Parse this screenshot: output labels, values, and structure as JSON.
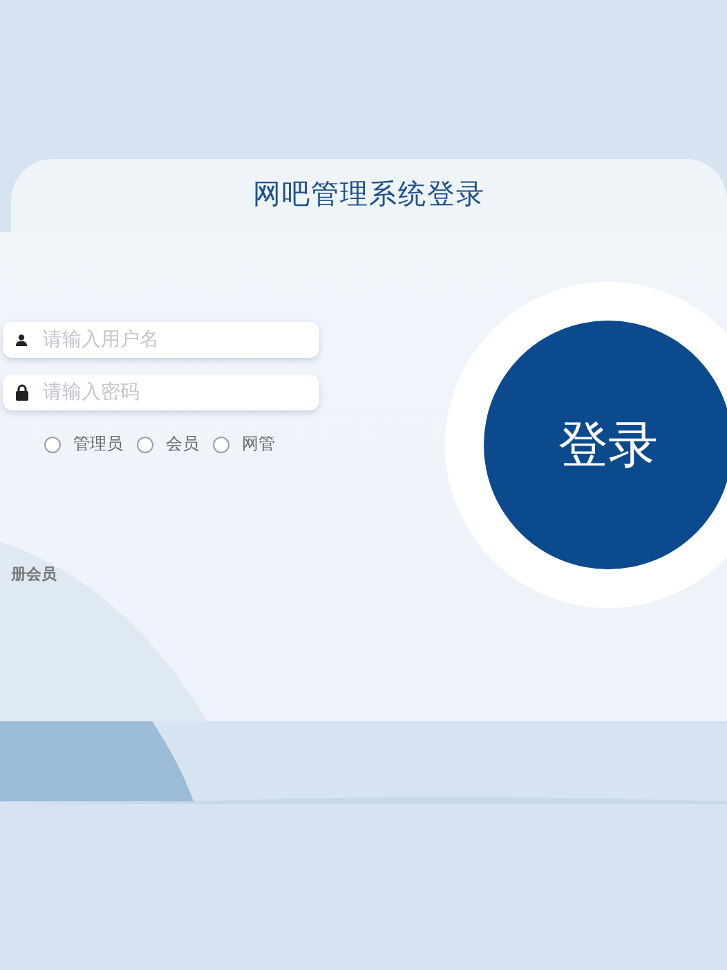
{
  "title": "网吧管理系统登录",
  "fields": [
    {
      "kind": "user",
      "placeholder": "请输入用户名"
    },
    {
      "kind": "lock",
      "placeholder": "请输入密码"
    }
  ],
  "roles": [
    {
      "label": "管理员",
      "selected": false
    },
    {
      "label": "会员",
      "selected": false
    },
    {
      "label": "网管",
      "selected": false
    }
  ],
  "register_link": "册会员",
  "login_button": "登录"
}
